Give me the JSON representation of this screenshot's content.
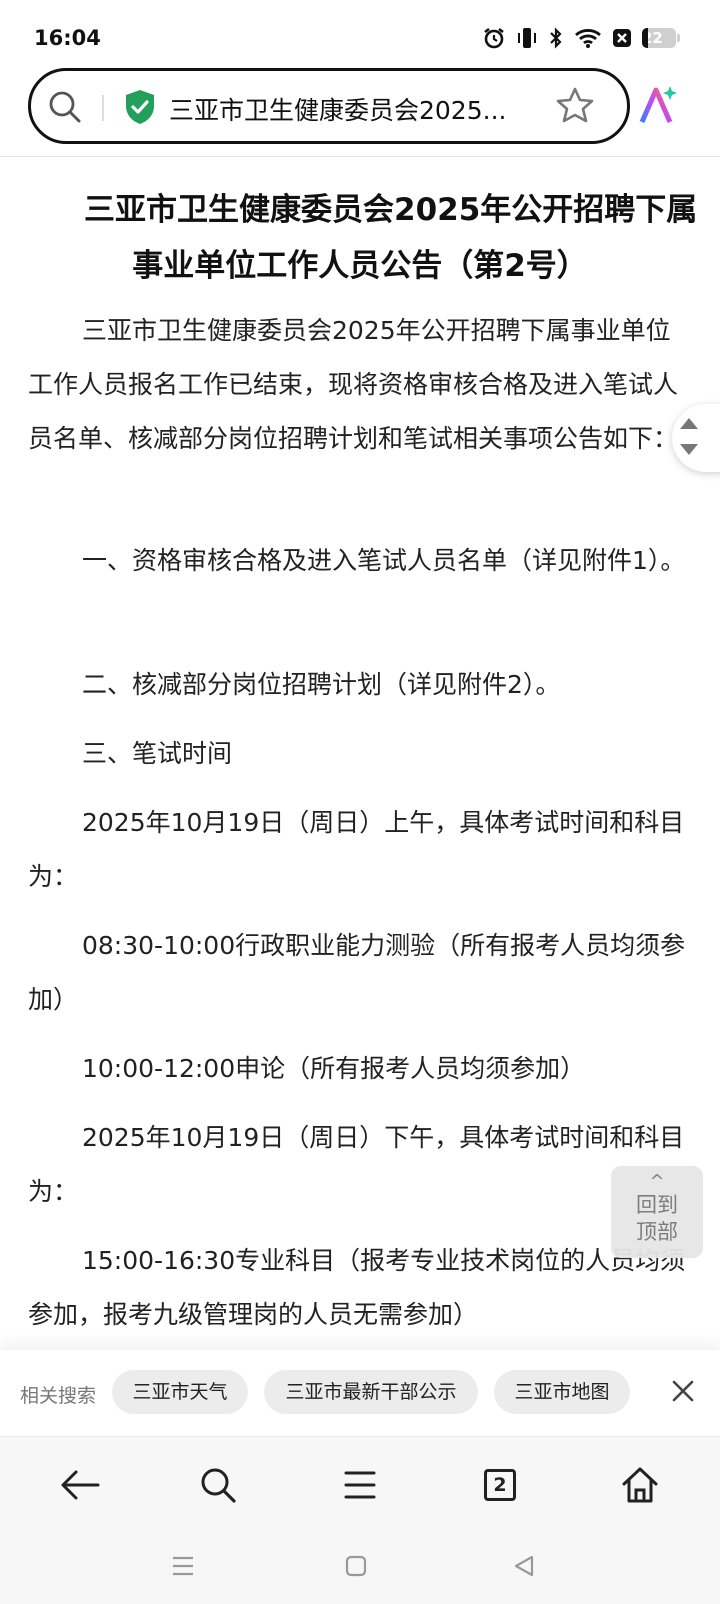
{
  "status_bar": {
    "time": "16:04",
    "battery": "22",
    "icons": [
      "alarm-icon",
      "vibrate-icon",
      "bluetooth-icon",
      "wifi-icon",
      "close-box-icon",
      "battery-icon"
    ]
  },
  "address_bar": {
    "url_text": "三亚市卫生健康委员会2025...",
    "icons": [
      "search-icon",
      "shield-check-icon",
      "star-icon",
      "ai-icon"
    ],
    "accent": "#22a05b"
  },
  "article": {
    "title_lines": [
      "三亚市卫生健康委员会2025年公开招聘下属",
      "事业单位工作人员公告（第2号）"
    ],
    "paragraphs": [
      "三亚市卫生健康委员会2025年公开招聘下属事业单位工作人员报名工作已结束，现将资格审核合格及进入笔试人员名单、核减部分岗位招聘计划和笔试相关事项公告如下：",
      "一、资格审核合格及进入笔试人员名单（详见附件1）。",
      "二、核减部分岗位招聘计划（详见附件2）。",
      "三、笔试时间",
      "2025年10月19日（周日）上午，具体考试时间和科目为：",
      "08:30-10:00行政职业能力测验（所有报考人员均须参加）",
      "10:00-12:00申论（所有报考人员均须参加）",
      "2025年10月19日（周日）下午，具体考试时间和科目为：",
      "15:00-16:30专业科目（报考专业技术岗位的人员均须参加，报考九级管理岗的人员无需参加）"
    ]
  },
  "back_to_top": {
    "line1": "回到",
    "line2": "顶部"
  },
  "related": {
    "label": "相关搜索",
    "chips": [
      "三亚市天气",
      "三亚市最新干部公示",
      "三亚市地图"
    ]
  },
  "bottom_nav": {
    "tab_count": "2",
    "icons": [
      "back-arrow-icon",
      "search-icon",
      "menu-icon",
      "tabs-icon",
      "home-icon"
    ]
  }
}
